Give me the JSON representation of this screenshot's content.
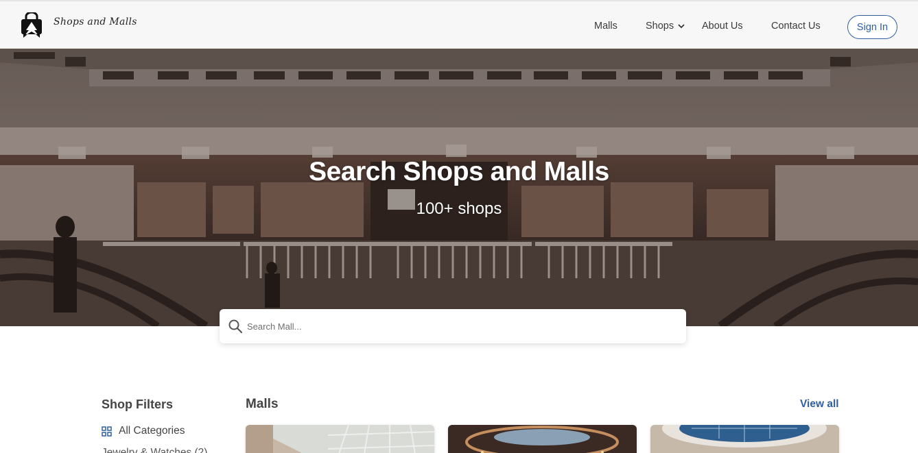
{
  "brand": {
    "name": "Shops and Malls"
  },
  "nav": {
    "malls": "Malls",
    "shops": "Shops",
    "about": "About Us",
    "contact": "Contact Us",
    "signin": "Sign In"
  },
  "hero": {
    "title": "Search Shops and Malls",
    "subtitle": "100+ shops"
  },
  "search": {
    "placeholder": "Search Mall..."
  },
  "filters": {
    "title": "Shop Filters",
    "items": [
      "All Categories",
      "Jewelry & Watches (2)"
    ]
  },
  "malls": {
    "title": "Malls",
    "view_all": "View all"
  },
  "colors": {
    "accent": "#2f5ea0",
    "topbar": "#f7f7f7"
  }
}
